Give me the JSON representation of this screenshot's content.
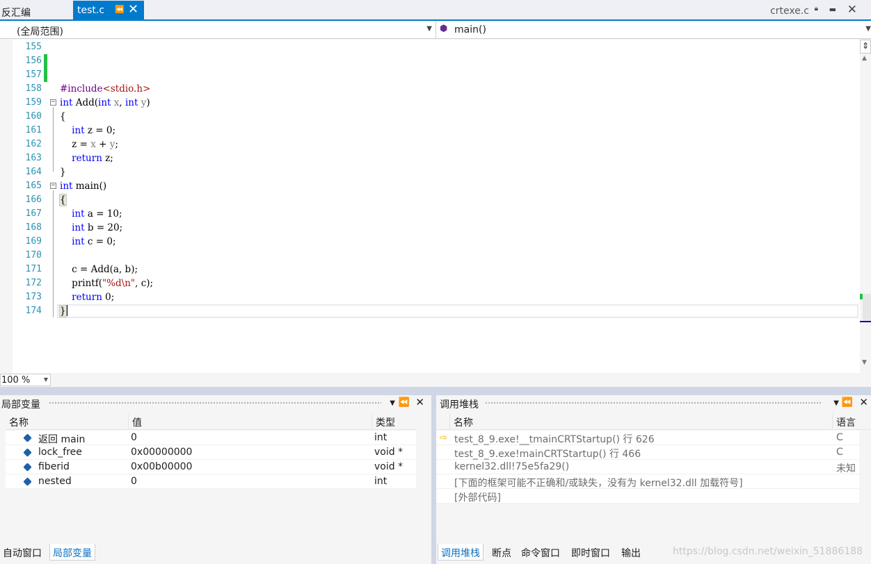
{
  "tabs": {
    "left_tab": "反汇编",
    "active_tab": "test.c",
    "right_tab": "crtexe.c"
  },
  "navbar": {
    "scope": "(全局范围)",
    "member": "main()"
  },
  "editor": {
    "line_numbers": [
      "155",
      "156",
      "157",
      "158",
      "159",
      "160",
      "161",
      "162",
      "163",
      "164",
      "165",
      "166",
      "167",
      "168",
      "169",
      "170",
      "171",
      "172",
      "173",
      "174"
    ],
    "lines": {
      "l158_a": "#include",
      "l158_b": "<stdio.h>",
      "l159_kw1": "int",
      "l159_name": " Add(",
      "l159_kw2": "int",
      "l159_p1": " x",
      "l159_sep": ", ",
      "l159_kw3": "int",
      "l159_p2": " y",
      "l159_end": ")",
      "l160": "{",
      "l161_kw": "int",
      "l161_rest": " z = 0;",
      "l162_a": "z = ",
      "l162_x": "x",
      "l162_op": " + ",
      "l162_y": "y",
      "l162_end": ";",
      "l163_kw": "return",
      "l163_rest": " z;",
      "l164": "}",
      "l165_kw": "int",
      "l165_rest": " main()",
      "l166": "{",
      "l167_kw": "int",
      "l167_rest": " a = 10;",
      "l168_kw": "int",
      "l168_rest": " b = 20;",
      "l169_kw": "int",
      "l169_rest": " c = 0;",
      "l171": "c = Add(a, b);",
      "l172_a": "printf(",
      "l172_str": "\"%d\\n\"",
      "l172_b": ", c);",
      "l173_kw": "return",
      "l173_rest": " 0;",
      "l174": "}"
    }
  },
  "zoom": "100 %",
  "locals": {
    "title": "局部变量",
    "headers": [
      "名称",
      "值",
      "类型"
    ],
    "rows": [
      {
        "name": "返回 main",
        "value": "0",
        "type": "int"
      },
      {
        "name": "lock_free",
        "value": "0x00000000",
        "type": "void *"
      },
      {
        "name": "fiberid",
        "value": "0x00b00000",
        "type": "void *"
      },
      {
        "name": "nested",
        "value": "0",
        "type": "int"
      }
    ],
    "tabs": [
      "自动窗口",
      "局部变量"
    ]
  },
  "callstack": {
    "title": "调用堆栈",
    "headers": [
      "名称",
      "语言"
    ],
    "rows": [
      {
        "name": "test_8_9.exe!__tmainCRTStartup() 行 626",
        "lang": "C"
      },
      {
        "name": "test_8_9.exe!mainCRTStartup() 行 466",
        "lang": "C"
      },
      {
        "name": "kernel32.dll!75e5fa29()",
        "lang": "未知"
      },
      {
        "name": "[下面的框架可能不正确和/或缺失，没有为 kernel32.dll 加载符号]",
        "lang": ""
      },
      {
        "name": "[外部代码]",
        "lang": ""
      }
    ],
    "tabs": [
      "调用堆栈",
      "断点",
      "命令窗口",
      "即时窗口",
      "输出"
    ],
    "watermark": "https://blog.csdn.net/weixin_51886188"
  },
  "icons": {
    "pin": "pin-icon",
    "close": "close-icon",
    "lock": "lock-icon",
    "dropdown": "chevron-down-icon",
    "method": "method-cube-icon",
    "local_var": "local-variable-icon",
    "current_frame": "current-frame-arrow-icon"
  },
  "colors": {
    "accent": "#007acc",
    "keyword": "#0000ff",
    "preprocessor": "#6f008a",
    "string": "#a31515",
    "line_number": "#2b91af",
    "change_marker": "#22c144"
  }
}
